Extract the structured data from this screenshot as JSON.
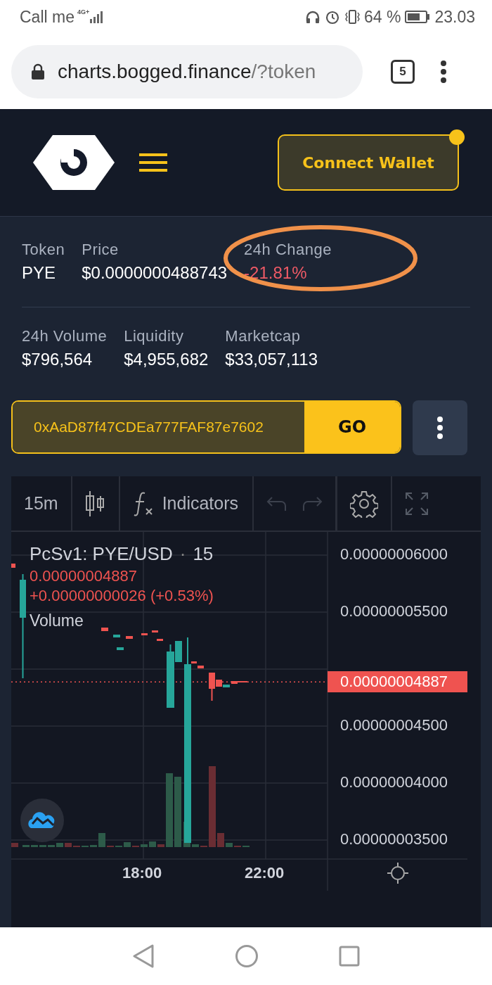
{
  "status_bar": {
    "carrier": "Call me",
    "network": "4G+",
    "battery": "64 %",
    "time": "23.03"
  },
  "browser": {
    "url_host": "charts.bogged.finance",
    "url_path": "/?token",
    "tab_count": "5"
  },
  "header": {
    "connect_button": "Connect Wallet",
    "notification": true
  },
  "stats": [
    [
      {
        "label": "Token",
        "value": "PYE",
        "negative": false
      },
      {
        "label": "Price",
        "value": "$0.0000000488743",
        "negative": false
      },
      {
        "label": "24h Change",
        "value": "-21.81%",
        "negative": true
      }
    ],
    [
      {
        "label": "24h Volume",
        "value": "$796,564",
        "negative": false
      },
      {
        "label": "Liquidity",
        "value": "$4,955,682",
        "negative": false
      },
      {
        "label": "Marketcap",
        "value": "$33,057,113",
        "negative": false
      }
    ]
  ],
  "token_search": {
    "value": "0xAaD87f47CDEa777FAF87e7602",
    "button": "GO"
  },
  "chart": {
    "interval": "15m",
    "indicators": "Indicators",
    "history_enabled": false,
    "legend": {
      "symbol": "PcSv1: PYE/USD",
      "separator": "·",
      "interval": "15",
      "price": "0.00000004887",
      "change": "+0.00000000026 (+0.53%)",
      "volume": "Volume"
    },
    "price_axis": [
      "0.00000006000",
      "0.00000005500",
      "0.00000004500",
      "0.00000004000",
      "0.00000003500"
    ],
    "last_price": "0.00000004887",
    "time_axis": [
      "18:00",
      "22:00"
    ]
  }
}
